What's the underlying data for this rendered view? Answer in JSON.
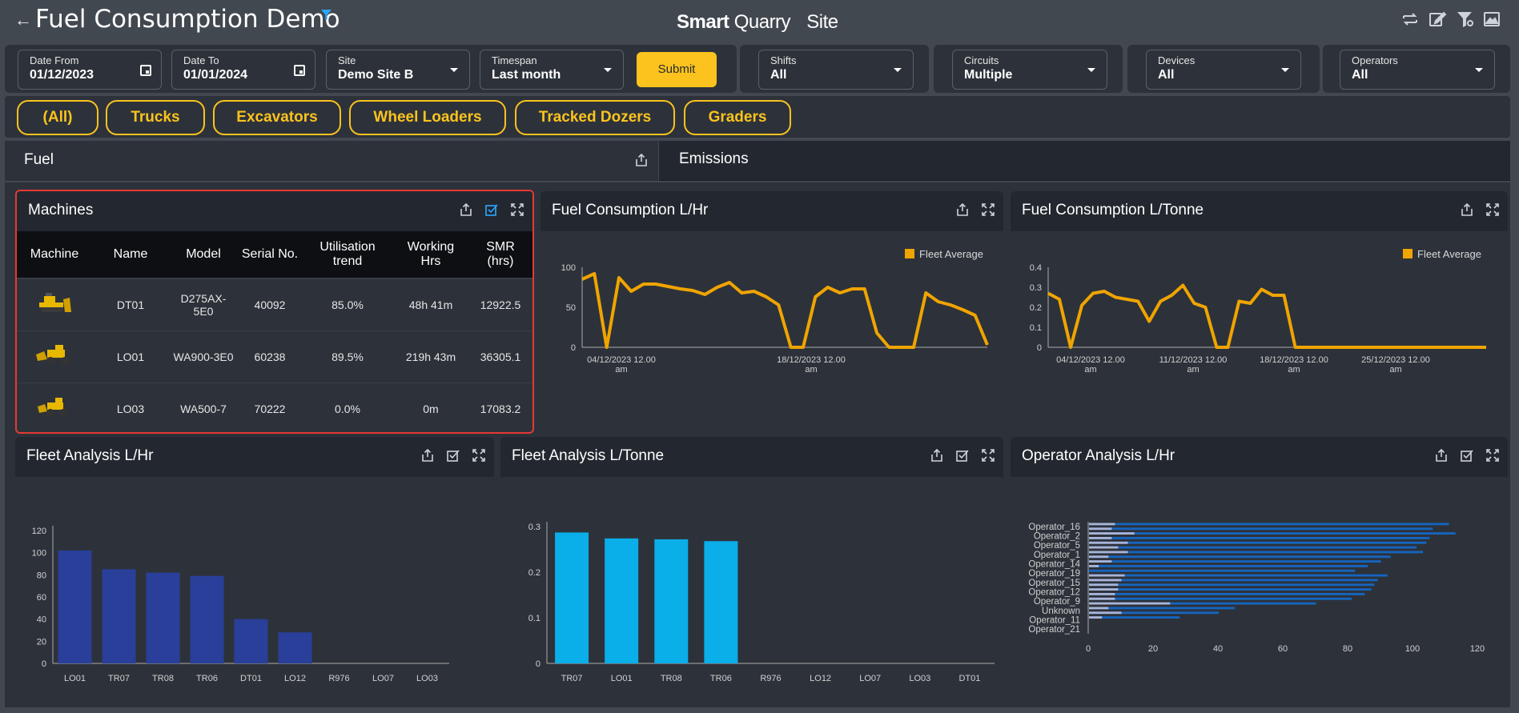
{
  "header": {
    "back_icon": "arrow-left-icon",
    "title": "Fuel Consumption Demo",
    "brand_smart": "Smart",
    "brand_quarry": "Quarry",
    "brand_site": "Site",
    "icons": [
      "sync-icon",
      "edit-icon",
      "filter-settings-icon",
      "image-icon"
    ]
  },
  "filters": {
    "date_from": {
      "label": "Date From",
      "value": "01/12/2023"
    },
    "date_to": {
      "label": "Date To",
      "value": "01/01/2024"
    },
    "site": {
      "label": "Site",
      "value": "Demo Site B"
    },
    "timespan": {
      "label": "Timespan",
      "value": "Last month"
    },
    "submit": "Submit",
    "shifts": {
      "label": "Shifts",
      "value": "All"
    },
    "circuits": {
      "label": "Circuits",
      "value": "Multiple"
    },
    "devices": {
      "label": "Devices",
      "value": "All"
    },
    "operators": {
      "label": "Operators",
      "value": "All"
    }
  },
  "categories": [
    "(All)",
    "Trucks",
    "Excavators",
    "Wheel Loaders",
    "Tracked Dozers",
    "Graders"
  ],
  "sections": {
    "fuel": "Fuel",
    "emissions": "Emissions"
  },
  "machines": {
    "title": "Machines",
    "columns": [
      "Machine",
      "Name",
      "Model",
      "Serial No.",
      "Utilisation trend",
      "Working Hrs",
      "SMR (hrs)"
    ],
    "rows": [
      {
        "icon": "dozer-icon",
        "name": "DT01",
        "model": "D275AX-5E0",
        "serial": "40092",
        "util": "85.0%",
        "hrs": "48h 41m",
        "smr": "12922.5"
      },
      {
        "icon": "wheel-loader-icon",
        "name": "LO01",
        "model": "WA900-3E0",
        "serial": "60238",
        "util": "89.5%",
        "hrs": "219h 43m",
        "smr": "36305.1"
      },
      {
        "icon": "wheel-loader-icon",
        "name": "LO03",
        "model": "WA500-7",
        "serial": "70222",
        "util": "0.0%",
        "hrs": "0m",
        "smr": "17083.2"
      }
    ]
  },
  "fuel_hr_title": "Fuel Consumption L/Hr",
  "fuel_tonne_title": "Fuel Consumption L/Tonne",
  "fleet_hr_title": "Fleet Analysis L/Hr",
  "fleet_tonne_title": "Fleet Analysis L/Tonne",
  "operator_title": "Operator Analysis L/Hr",
  "colors": {
    "accent": "#fcc31e",
    "line": "#f0a400",
    "bar_dark": "#2a3f9a",
    "bar_light": "#0aaee8",
    "op_bar": "#1565c0",
    "op_bar2": "#aab4d6",
    "alert": "#e53935"
  },
  "chart_data": [
    {
      "type": "line",
      "title": "Fuel Consumption L/Hr",
      "legend": "Fleet Average",
      "legend_position": "top-right",
      "xticks": [
        "04/12/2023 12.00 am",
        "18/12/2023 12.00 am"
      ],
      "ylim": [
        0,
        100
      ],
      "yticks": [
        0,
        50,
        100
      ],
      "series": [
        {
          "name": "Fleet Average",
          "values": [
            85,
            92,
            0,
            87,
            70,
            79,
            79,
            76,
            73,
            71,
            66,
            75,
            81,
            68,
            70,
            63,
            53,
            0,
            0,
            63,
            75,
            68,
            73,
            73,
            18,
            0,
            0,
            0,
            68,
            57,
            53,
            47,
            40,
            3
          ]
        }
      ]
    },
    {
      "type": "line",
      "title": "Fuel Consumption L/Tonne",
      "legend": "Fleet Average",
      "legend_position": "top-right",
      "xticks": [
        "04/12/2023 12.00 am",
        "11/12/2023 12.00 am",
        "18/12/2023 12.00 am",
        "25/12/2023 12.00 am"
      ],
      "ylim": [
        0,
        0.4
      ],
      "yticks": [
        0,
        0.1,
        0.2,
        0.3,
        0.4
      ],
      "series": [
        {
          "name": "Fleet Average",
          "values": [
            0.27,
            0.24,
            0,
            0.21,
            0.27,
            0.28,
            0.25,
            0.24,
            0.23,
            0.13,
            0.23,
            0.26,
            0.31,
            0.22,
            0.2,
            0,
            0,
            0.23,
            0.22,
            0.29,
            0.26,
            0.26,
            0,
            0,
            0,
            0,
            0,
            0,
            0,
            0,
            0,
            0,
            0,
            0,
            0,
            0,
            0,
            0,
            0,
            0
          ]
        }
      ]
    },
    {
      "type": "bar",
      "title": "Fleet Analysis L/Hr",
      "categories": [
        "LO01",
        "TR07",
        "TR08",
        "TR06",
        "DT01",
        "LO12",
        "R976",
        "LO07",
        "LO03"
      ],
      "values": [
        102,
        85,
        82,
        79,
        40,
        28,
        0,
        0,
        0
      ],
      "ylim": [
        0,
        120
      ],
      "yticks": [
        0,
        20,
        40,
        60,
        80,
        100,
        120
      ]
    },
    {
      "type": "bar",
      "title": "Fleet Analysis L/Tonne",
      "categories": [
        "TR07",
        "LO01",
        "TR08",
        "TR06",
        "R976",
        "LO12",
        "LO07",
        "LO03",
        "DT01"
      ],
      "values": [
        0.287,
        0.274,
        0.272,
        0.268,
        0,
        0,
        0,
        0,
        0
      ],
      "ylim": [
        0,
        0.3
      ],
      "yticks": [
        0,
        0.1,
        0.2,
        0.3
      ]
    },
    {
      "type": "bar",
      "orientation": "horizontal",
      "title": "Operator Analysis L/Hr",
      "category_labels": [
        "Operator_16",
        "Operator_2",
        "Operator_5",
        "Operator_1",
        "Operator_14",
        "Operator_19",
        "Operator_15",
        "Operator_12",
        "Operator_9",
        "Unknown",
        "Operator_11",
        "Operator_21"
      ],
      "xlim": [
        0,
        120
      ],
      "xticks": [
        0,
        20,
        40,
        60,
        80,
        100,
        120
      ],
      "series": [
        {
          "values": [
            111,
            106,
            113,
            105,
            104,
            101,
            103,
            93,
            90,
            86,
            82,
            92,
            89,
            88,
            87,
            85,
            81,
            70,
            45,
            40,
            28,
            0,
            0,
            0
          ]
        },
        {
          "values": [
            8,
            7,
            14,
            7,
            12,
            9,
            12,
            6,
            7,
            3,
            0,
            11,
            10,
            9,
            9,
            8,
            8,
            25,
            6,
            10,
            4,
            0,
            0,
            0
          ]
        }
      ]
    }
  ]
}
